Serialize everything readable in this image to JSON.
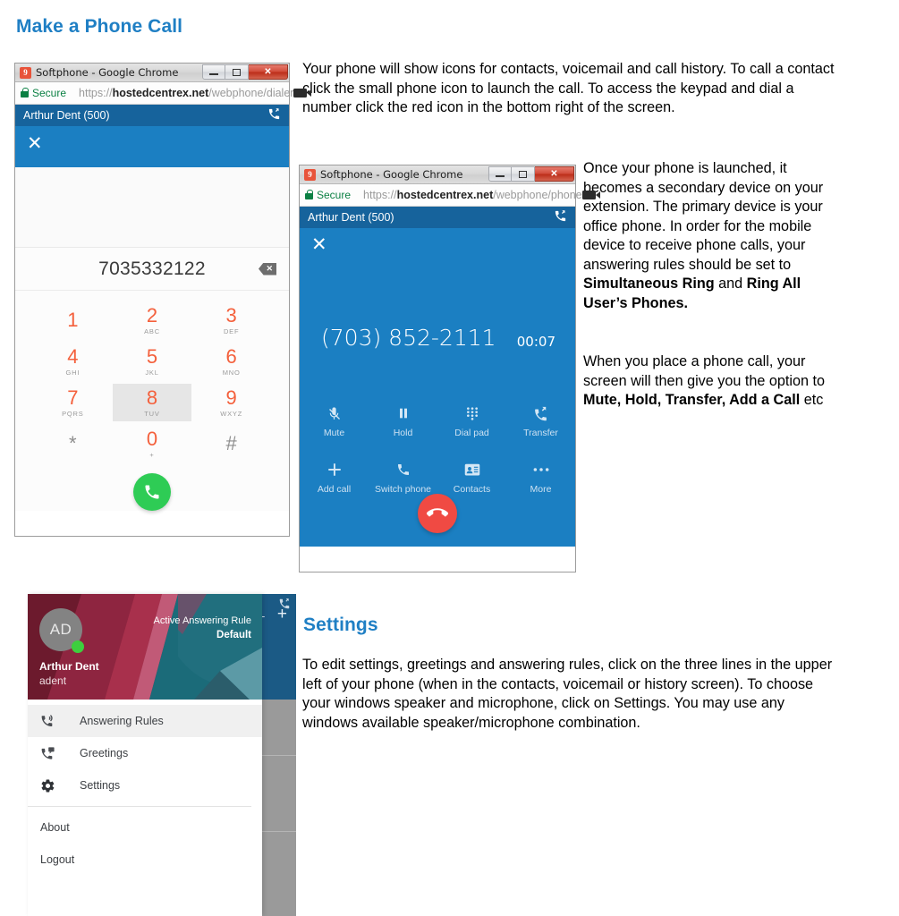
{
  "page": {
    "heading_1": "Make a Phone Call",
    "heading_2": "Settings",
    "accent_blue": "#1f7fc4",
    "app_blue_header": "#16639c",
    "app_blue_body": "#1b7fc2"
  },
  "paragraphs": {
    "p1": "Your phone will show icons for contacts, voicemail and call history.  To call a contact click the small phone icon to launch the call.  To access the keypad and dial a number click the red icon in the bottom right of the screen.",
    "p2_part1": "Once your phone is launched, it becomes a secondary device on your extension.  The primary device is your office phone.  In order for the mobile device to receive phone calls, your answering rules should be set to ",
    "p2_bold1": "Simultaneous Ring",
    "p2_mid": " and ",
    "p2_bold2": "Ring All User’s Phones.",
    "p3_part1": "When you place a phone call, your screen will then give you the option to ",
    "p3_bold1": "Mute, Hold, Transfer, Add a Call",
    "p3_end": " etc",
    "p4": "To edit settings, greetings and answering rules, click on the three lines in the upper left of your phone (when in the contacts, voicemail or history screen).  To choose your windows speaker and microphone, click on Settings.  You may use any windows available speaker/microphone combination."
  },
  "dialer_window": {
    "titlebar": {
      "favicon_text": "9",
      "title": "Softphone - Google Chrome",
      "minimize": "–",
      "maximize": "□",
      "close": "✕"
    },
    "urlbar": {
      "secure_label": "Secure",
      "scheme": "https://",
      "host": "hostedcentrex.net",
      "path": "/webphone/dialer"
    },
    "app_header": {
      "extension": "Arthur Dent (500)"
    },
    "close_button": "✕",
    "display_number": "7035332122",
    "keys": [
      {
        "digit": "1",
        "letters": ""
      },
      {
        "digit": "2",
        "letters": "ABC"
      },
      {
        "digit": "3",
        "letters": "DEF"
      },
      {
        "digit": "4",
        "letters": "GHI"
      },
      {
        "digit": "5",
        "letters": "JKL"
      },
      {
        "digit": "6",
        "letters": "MNO"
      },
      {
        "digit": "7",
        "letters": "PQRS"
      },
      {
        "digit": "8",
        "letters": "TUV"
      },
      {
        "digit": "9",
        "letters": "WXYZ"
      },
      {
        "digit": "*",
        "letters": ""
      },
      {
        "digit": "0",
        "letters": "+"
      },
      {
        "digit": "#",
        "letters": ""
      }
    ],
    "pressed_key": "8"
  },
  "call_window": {
    "titlebar": {
      "favicon_text": "9",
      "title": "Softphone - Google Chrome",
      "minimize": "–",
      "maximize": "□",
      "close": "✕"
    },
    "urlbar": {
      "secure_label": "Secure",
      "scheme": "https://",
      "host": "hostedcentrex.net",
      "path": "/webphone/phone"
    },
    "app_header": {
      "extension": "Arthur Dent (500)"
    },
    "close_button": "✕",
    "caller_number": "(703) 852-2111",
    "timer": "00:07",
    "actions_row1": [
      {
        "label": "Mute",
        "icon": "mute-icon"
      },
      {
        "label": "Hold",
        "icon": "pause-icon"
      },
      {
        "label": "Dial pad",
        "icon": "dialpad-icon"
      },
      {
        "label": "Transfer",
        "icon": "transfer-icon"
      }
    ],
    "actions_row2": [
      {
        "label": "Add call",
        "icon": "plus-icon"
      },
      {
        "label": "Switch phone",
        "icon": "phone-icon"
      },
      {
        "label": "Contacts",
        "icon": "contacts-icon"
      },
      {
        "label": "More",
        "icon": "more-icon"
      }
    ]
  },
  "settings_drawer": {
    "avatar_initials": "AD",
    "user_name": "Arthur Dent",
    "user_login": "adent",
    "active_rule_label": "Active Answering Rule",
    "active_rule_value": "Default",
    "menu": [
      {
        "label": "Answering Rules",
        "icon": "answering-rules-icon",
        "active": true
      },
      {
        "label": "Greetings",
        "icon": "greetings-icon",
        "active": false
      },
      {
        "label": "Settings",
        "icon": "gear-icon",
        "active": false
      }
    ],
    "footer": [
      {
        "label": "About"
      },
      {
        "label": "Logout"
      }
    ],
    "behind_plus": "+",
    "behind_minus": "-"
  }
}
